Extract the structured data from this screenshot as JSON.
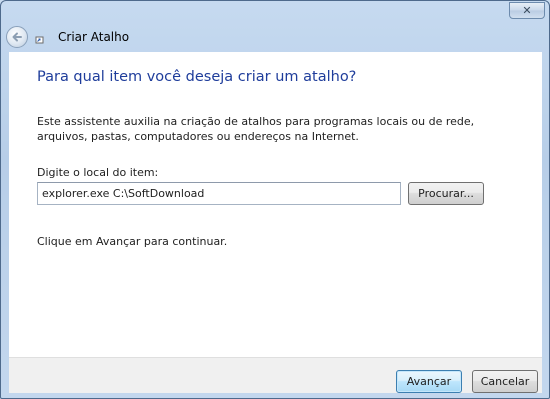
{
  "window": {
    "close_glyph": "✕"
  },
  "titlebar": {
    "title": "Criar Atalho",
    "back_icon": "back-arrow-icon",
    "app_icon": "shortcut-wizard-icon"
  },
  "main": {
    "heading": "Para qual item você deseja criar um atalho?",
    "description": "Este assistente auxilia na criação de atalhos para programas locais ou de rede, arquivos, pastas, computadores ou endereços na Internet.",
    "field_label": "Digite o local do item:",
    "location_value": "explorer.exe C:\\SoftDownload",
    "browse_label": "Procurar...",
    "hint": "Clique em Avançar para continuar."
  },
  "footer": {
    "next_label": "Avançar",
    "cancel_label": "Cancelar"
  },
  "colors": {
    "heading": "#1f3d9b",
    "frame": "#c6daf0"
  }
}
